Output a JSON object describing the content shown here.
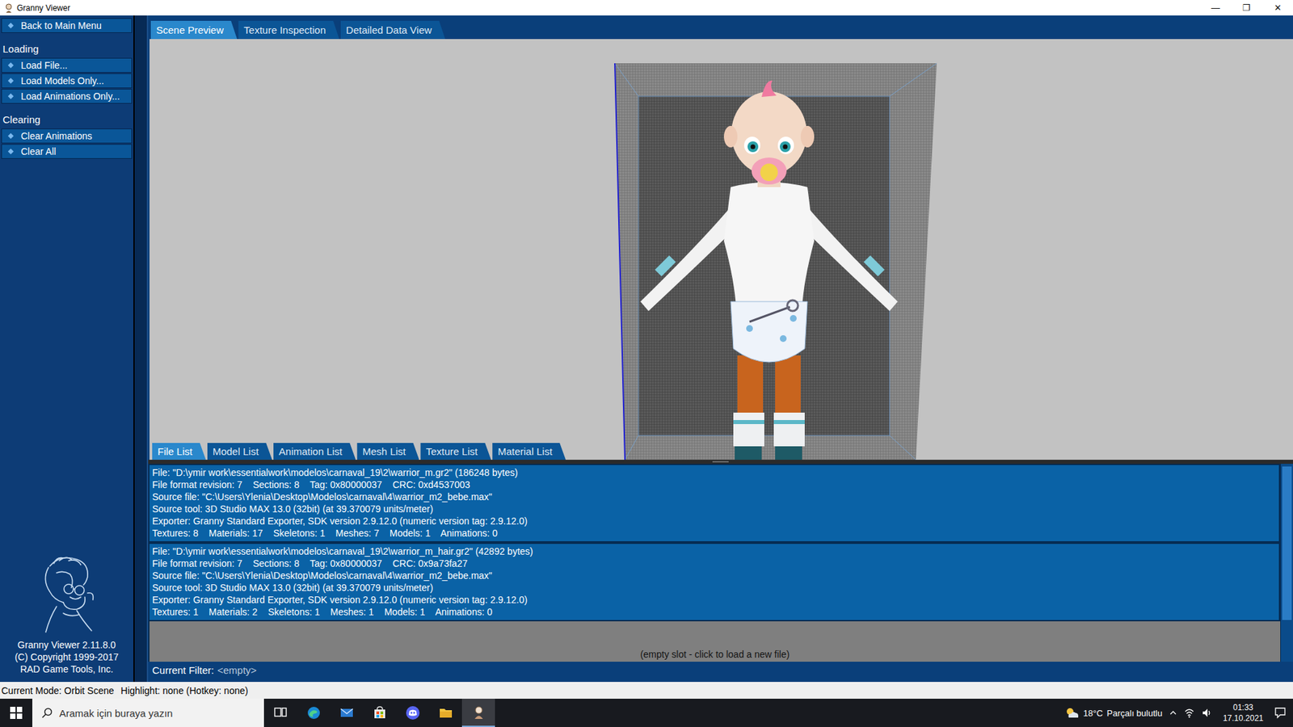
{
  "window": {
    "title": "Granny Viewer",
    "controls": [
      "—",
      "❐",
      "✕"
    ]
  },
  "sidebar": {
    "items": [
      {
        "kind": "button",
        "label": "Back to Main Menu"
      },
      {
        "kind": "header",
        "label": "Loading"
      },
      {
        "kind": "button",
        "label": "Load File..."
      },
      {
        "kind": "button",
        "label": "Load Models Only..."
      },
      {
        "kind": "button",
        "label": "Load Animations Only..."
      },
      {
        "kind": "header",
        "label": "Clearing"
      },
      {
        "kind": "button",
        "label": "Clear Animations"
      },
      {
        "kind": "button",
        "label": "Clear All"
      }
    ],
    "about": [
      "Granny Viewer 2.11.8.0",
      "(C) Copyright 1999-2017",
      "RAD Game Tools, Inc."
    ]
  },
  "top_tabs": [
    {
      "label": "Scene Preview",
      "selected": true
    },
    {
      "label": "Texture Inspection",
      "selected": false
    },
    {
      "label": "Detailed Data View",
      "selected": false
    }
  ],
  "bottom_tabs": [
    {
      "label": "File List",
      "selected": true
    },
    {
      "label": "Model List",
      "selected": false
    },
    {
      "label": "Animation List",
      "selected": false
    },
    {
      "label": "Mesh List",
      "selected": false
    },
    {
      "label": "Texture List",
      "selected": false
    },
    {
      "label": "Material List",
      "selected": false
    }
  ],
  "files": [
    {
      "lines": [
        "File: \"D:\\ymir work\\essentialwork\\modelos\\carnaval_19\\2\\warrior_m.gr2\" (186248 bytes)",
        "File format revision: 7    Sections: 8    Tag: 0x80000037    CRC: 0xd4537003",
        "Source file: \"C:\\Users\\Ylenia\\Desktop\\Modelos\\carnaval\\4\\warrior_m2_bebe.max\"",
        "Source tool: 3D Studio MAX 13.0 (32bit) (at 39.370079 units/meter)",
        "Exporter: Granny Standard Exporter, SDK version 2.9.12.0 (numeric version tag: 2.9.12.0)",
        "Textures: 8    Materials: 17    Skeletons: 1    Meshes: 7    Models: 1    Animations: 0"
      ]
    },
    {
      "lines": [
        "File: \"D:\\ymir work\\essentialwork\\modelos\\carnaval_19\\2\\warrior_m_hair.gr2\" (42892 bytes)",
        "File format revision: 7    Sections: 8    Tag: 0x80000037    CRC: 0x9a73fa27",
        "Source file: \"C:\\Users\\Ylenia\\Desktop\\Modelos\\carnaval\\4\\warrior_m2_bebe.max\"",
        "Source tool: 3D Studio MAX 13.0 (32bit) (at 39.370079 units/meter)",
        "Exporter: Granny Standard Exporter, SDK version 2.9.12.0 (numeric version tag: 2.9.12.0)",
        "Textures: 1    Materials: 2    Skeletons: 1    Meshes: 1    Models: 1    Animations: 0"
      ]
    }
  ],
  "empty_slot": "(empty slot - click to load a new file)",
  "filter": {
    "label": "Current Filter:",
    "value": "<empty>"
  },
  "status_bar": {
    "mode": "Current Mode: Orbit Scene",
    "highlight": "Highlight: none (Hotkey: none)"
  },
  "taskbar": {
    "search_placeholder": "Aramak için buraya yazın",
    "weather_temp": "18°C",
    "weather_text": "Parçalı bulutlu",
    "time": "01:33",
    "date": "17.10.2021"
  }
}
